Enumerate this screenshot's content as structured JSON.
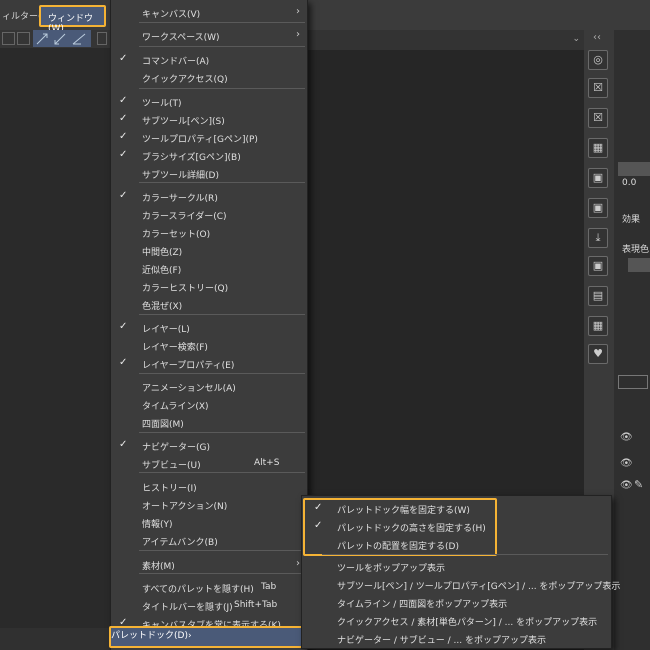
{
  "menubar": {
    "filter": "ィルター(I)",
    "window": "ウィンドウ(W)"
  },
  "right_panel": {
    "field": "0.0",
    "effect": "効果",
    "expression": "表現色"
  },
  "window_menu": {
    "items": [
      {
        "label": "キャンバス(V)",
        "checked": false,
        "submenu": true
      },
      {
        "label": "ワークスペース(W)",
        "checked": false,
        "submenu": true
      },
      {
        "label": "コマンドバー(A)",
        "checked": true
      },
      {
        "label": "クイックアクセス(Q)",
        "checked": false
      },
      {
        "label": "ツール(T)",
        "checked": true
      },
      {
        "label": "サブツール[ペン](S)",
        "checked": true
      },
      {
        "label": "ツールプロパティ[Gペン](P)",
        "checked": true
      },
      {
        "label": "ブラシサイズ[Gペン](B)",
        "checked": true
      },
      {
        "label": "サブツール詳細(D)",
        "checked": false
      },
      {
        "label": "カラーサークル(R)",
        "checked": true
      },
      {
        "label": "カラースライダー(C)",
        "checked": false
      },
      {
        "label": "カラーセット(O)",
        "checked": false
      },
      {
        "label": "中間色(Z)",
        "checked": false
      },
      {
        "label": "近似色(F)",
        "checked": false
      },
      {
        "label": "カラーヒストリー(Q)",
        "checked": false
      },
      {
        "label": "色混ぜ(X)",
        "checked": false
      },
      {
        "label": "レイヤー(L)",
        "checked": true
      },
      {
        "label": "レイヤー検索(F)",
        "checked": false
      },
      {
        "label": "レイヤープロパティ(E)",
        "checked": true
      },
      {
        "label": "アニメーションセル(A)",
        "checked": false
      },
      {
        "label": "タイムライン(X)",
        "checked": false
      },
      {
        "label": "四面図(M)",
        "checked": false
      },
      {
        "label": "ナビゲーター(G)",
        "checked": true
      },
      {
        "label": "サブビュー(U)",
        "checked": false,
        "shortcut": "Alt+S"
      },
      {
        "label": "ヒストリー(I)",
        "checked": false
      },
      {
        "label": "オートアクション(N)",
        "checked": false
      },
      {
        "label": "情報(Y)",
        "checked": false
      },
      {
        "label": "アイテムバンク(B)",
        "checked": false
      },
      {
        "label": "素材(M)",
        "checked": false,
        "submenu": true
      },
      {
        "label": "すべてのパレットを隠す(H)",
        "checked": false,
        "shortcut": "Tab"
      },
      {
        "label": "タイトルバーを隠す(J)",
        "checked": false,
        "shortcut": "Shift+Tab"
      },
      {
        "label": "キャンバスタブを常に表示する(K)",
        "checked": true
      },
      {
        "label": "パレットドック(D)",
        "checked": false,
        "submenu": true
      }
    ]
  },
  "palette_dock_menu": {
    "items": [
      {
        "label": "パレットドック幅を固定する(W)",
        "checked": true
      },
      {
        "label": "パレットドックの高さを固定する(H)",
        "checked": true
      },
      {
        "label": "パレットの配置を固定する(D)",
        "checked": false
      },
      {
        "label": "ツールをポップアップ表示",
        "checked": false
      },
      {
        "label": "サブツール[ペン] / ツールプロパティ[Gペン] / ... をポップアップ表示",
        "checked": false
      },
      {
        "label": "タイムライン / 四面図をポップアップ表示",
        "checked": false
      },
      {
        "label": "クイックアクセス / 素材[単色パターン] / ... をポップアップ表示",
        "checked": false
      },
      {
        "label": "ナビゲーター / サブビュー / ... をポップアップ表示",
        "checked": false
      }
    ]
  }
}
